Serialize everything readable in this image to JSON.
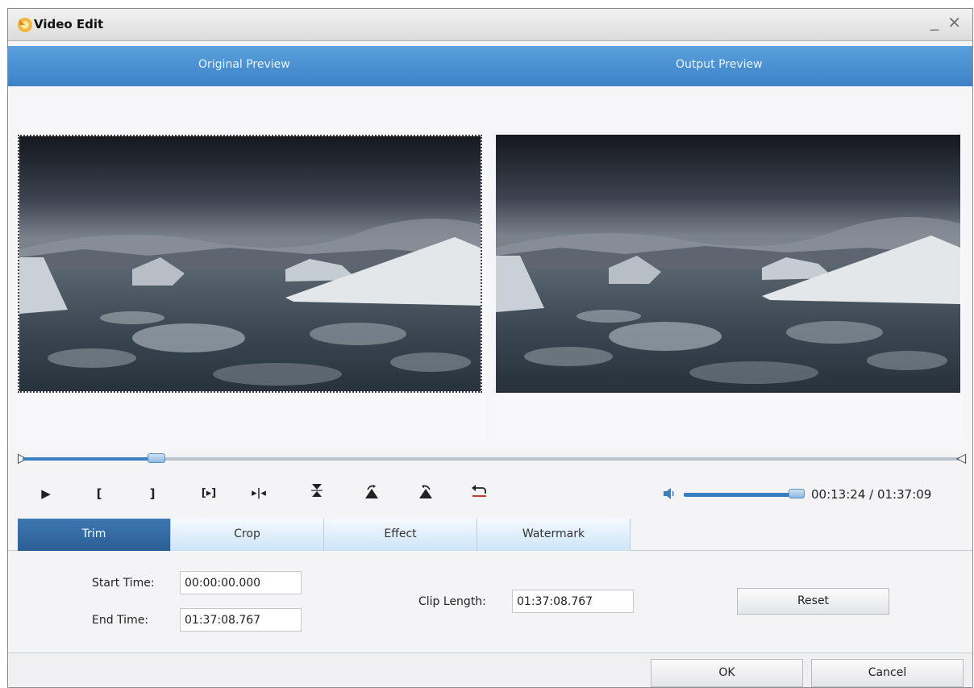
{
  "window": {
    "title": "Video Edit",
    "minimize_glyph": "_",
    "close_glyph": "✕"
  },
  "preview": {
    "original_label": "Original Preview",
    "output_label": "Output Preview"
  },
  "playback": {
    "seek_progress_fraction": 0.143,
    "volume_fraction": 1.0,
    "current_time": "00:13:24",
    "separator": " / ",
    "total_time": "01:37:09",
    "icons": [
      "play-icon",
      "mark-in-icon",
      "mark-out-icon",
      "play-selection-icon",
      "snapshot-icon",
      "flip-vertical-icon",
      "rotate-left-icon",
      "rotate-right-icon",
      "undo-icon",
      "volume-icon"
    ]
  },
  "tabs": [
    {
      "label": "Trim",
      "active": true
    },
    {
      "label": "Crop",
      "active": false
    },
    {
      "label": "Effect",
      "active": false
    },
    {
      "label": "Watermark",
      "active": false
    }
  ],
  "trim": {
    "start_label": "Start Time:",
    "start_value": "00:00:00.000",
    "end_label": "End Time:",
    "end_value": "01:37:08.767",
    "clip_length_label": "Clip Length:",
    "clip_length_value": "01:37:08.767",
    "reset_label": "Reset"
  },
  "footer": {
    "ok_label": "OK",
    "cancel_label": "Cancel"
  },
  "colors": {
    "accent": "#3d82c6",
    "active_tab": "#2b5f95",
    "inactive_tab": "#cde4f7"
  }
}
